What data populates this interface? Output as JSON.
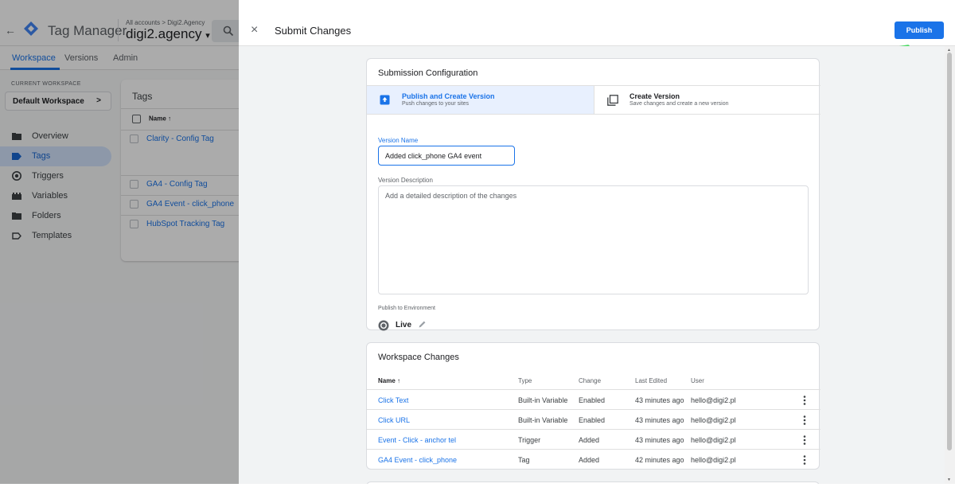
{
  "bg_app": {
    "back_icon": "arrow-left-icon",
    "product_name": "Tag Manager",
    "breadcrumb": "All accounts > Digi2.Agency",
    "container_name": "digi2.agency",
    "container_caret": "▾",
    "search_icon": "search-icon",
    "nav_tabs": [
      {
        "label": "Workspace"
      },
      {
        "label": "Versions"
      },
      {
        "label": "Admin"
      }
    ],
    "current_workspace_label": "CURRENT WORKSPACE",
    "workspace_name": "Default Workspace",
    "workspace_chevron": ">",
    "sidebar": [
      {
        "label": "Overview",
        "icon": "folder-icon"
      },
      {
        "label": "Tags",
        "icon": "tag-icon"
      },
      {
        "label": "Triggers",
        "icon": "trigger-icon"
      },
      {
        "label": "Variables",
        "icon": "variables-icon"
      },
      {
        "label": "Folders",
        "icon": "folder-icon"
      },
      {
        "label": "Templates",
        "icon": "template-icon"
      }
    ],
    "tags_card": {
      "title": "Tags",
      "header_name": "Name ↑",
      "rows": [
        {
          "name": "Clarity - Config Tag"
        },
        {
          "name": "GA4 - Config Tag"
        },
        {
          "name": "GA4 Event - click_phone"
        },
        {
          "name": "HubSpot Tracking Tag"
        }
      ]
    }
  },
  "panel": {
    "close_icon": "×",
    "title": "Submit Changes",
    "publish_label": "Publish",
    "submission": {
      "title": "Submission Configuration",
      "option_publish": {
        "title": "Publish and Create Version",
        "subtitle": "Push changes to your sites",
        "icon": "publish-icon"
      },
      "option_create": {
        "title": "Create Version",
        "subtitle": "Save changes and create a new version",
        "icon": "version-icon"
      },
      "version_name_label": "Version Name",
      "version_name_value": "Added click_phone GA4 event",
      "version_description_label": "Version Description",
      "version_description_placeholder": "Add a detailed description of the changes",
      "environment_label": "Publish to Environment",
      "environment_value": "Live"
    },
    "workspace_changes": {
      "title": "Workspace Changes",
      "columns": [
        "Name ↑",
        "Type",
        "Change",
        "Last Edited",
        "User"
      ],
      "rows": [
        {
          "name": "Click Text",
          "type": "Built-in Variable",
          "change": "Enabled",
          "edited": "43 minutes ago",
          "user": "hello@digi2.pl"
        },
        {
          "name": "Click URL",
          "type": "Built-in Variable",
          "change": "Enabled",
          "edited": "43 minutes ago",
          "user": "hello@digi2.pl"
        },
        {
          "name": "Event - Click - anchor tel",
          "type": "Trigger",
          "change": "Added",
          "edited": "43 minutes ago",
          "user": "hello@digi2.pl"
        },
        {
          "name": "GA4 Event - click_phone",
          "type": "Tag",
          "change": "Added",
          "edited": "42 minutes ago",
          "user": "hello@digi2.pl"
        }
      ]
    }
  },
  "colors": {
    "accent": "#1a73e8",
    "selected_option_bg": "#e8f0fe",
    "annotation_arrow": "#4cd964"
  }
}
